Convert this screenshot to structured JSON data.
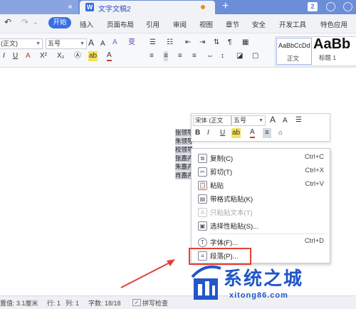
{
  "tabbar": {
    "doc_tab_title": "文字文稿2",
    "new_tab": "+",
    "badge_num": "2"
  },
  "menubar": {
    "undo": "↶",
    "redo": "↷",
    "items": [
      "开始",
      "插入",
      "页面布局",
      "引用",
      "审阅",
      "视图",
      "章节",
      "安全",
      "开发工具",
      "特色应用"
    ]
  },
  "ribbon": {
    "font_name": "(正文)",
    "font_size": "五号",
    "grow": "A",
    "shrink": "A",
    "clear": "A",
    "phonetic": "变",
    "bold": "B",
    "italic": "I",
    "underline": "U",
    "font_color": "A",
    "superscript": "X²",
    "subscript": "X₂",
    "highlight": "ab",
    "style_normal_preview": "AaBbCcDd",
    "style_normal_label": "正文",
    "style_h1_preview": "AaBb",
    "style_h1_label": "标题 1"
  },
  "document": {
    "selected_lines": [
      "张领导",
      "朱领导",
      "校领导",
      "张嘉卉",
      "朱嘉卉",
      "肖嘉卉"
    ]
  },
  "minibar": {
    "font_name": "宋体 (正文",
    "font_size": "五号",
    "grow": "A",
    "shrink": "A",
    "bold": "B",
    "italic": "I",
    "underline": "U",
    "highlight": "ab",
    "font_color": "A"
  },
  "context_menu": {
    "items": [
      {
        "label": "复制(C)",
        "shortcut": "Ctrl+C",
        "icon": "copy-icon",
        "glyph": "⧉"
      },
      {
        "label": "剪切(T)",
        "shortcut": "Ctrl+X",
        "icon": "scissors-icon",
        "glyph": "✂"
      },
      {
        "label": "粘贴",
        "shortcut": "Ctrl+V",
        "icon": "paste-icon",
        "glyph": "📋"
      },
      {
        "label": "带格式粘贴(K)",
        "shortcut": "",
        "icon": "paste-format-icon",
        "glyph": "▤"
      },
      {
        "label": "只粘贴文本(T)",
        "shortcut": "",
        "icon": "paste-text-icon",
        "glyph": "A"
      },
      {
        "label": "选择性粘贴(S)...",
        "shortcut": "",
        "icon": "paste-special-icon",
        "glyph": "▣"
      },
      {
        "label": "字体(F)...",
        "shortcut": "Ctrl+D",
        "icon": "font-icon",
        "glyph": "T"
      },
      {
        "label": "段落(P)...",
        "shortcut": "",
        "icon": "paragraph-icon",
        "glyph": "≡"
      }
    ]
  },
  "statusbar": {
    "position": "置值: 3.1厘米",
    "row": "行: 1",
    "col": "列: 1",
    "word_count": "字数: 18/18",
    "spell_check": "拼写检查"
  },
  "watermark": {
    "name": "系统之城",
    "url": "xitong86.com"
  },
  "colors": {
    "accent": "#3b6fe3",
    "highlight_red": "#e2403a",
    "tab_bar": "#6c8dd8"
  }
}
